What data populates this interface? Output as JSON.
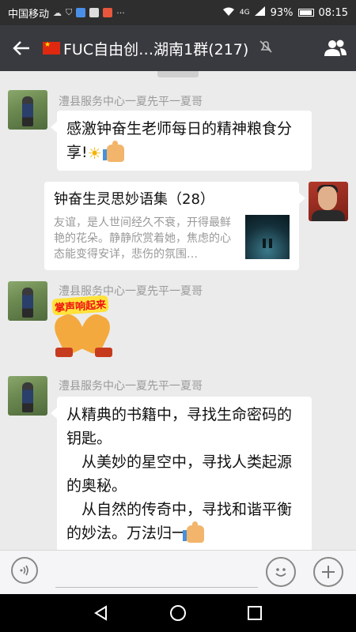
{
  "status": {
    "carrier": "中国移动",
    "network": "4G",
    "battery": "93%",
    "time": "08:15"
  },
  "header": {
    "back_icon": "arrow-left-icon",
    "title": "FUC自由创…湖南1群(217)",
    "mute_icon": "bell-muted-icon",
    "members_icon": "members-icon"
  },
  "messages": [
    {
      "type": "text",
      "sender": "澧县服务中心一夏先平一夏哥",
      "text": "感激钟奋生老师每日的精神粮食分享!",
      "emojis": [
        "sun",
        "thumbs-up"
      ]
    },
    {
      "type": "link",
      "self": true,
      "title": "钟奋生灵思妙语集（28）",
      "desc": "友谊，是人世间经久不衰，开得最鲜艳的花朵。静静欣赏着她，焦虑的心态能变得安详，悲伤的氛围…"
    },
    {
      "type": "sticker",
      "sender": "澧县服务中心一夏先平一夏哥",
      "label": "掌声响起来"
    },
    {
      "type": "text",
      "sender": "澧县服务中心一夏先平一夏哥",
      "lines": [
        "从精典的书籍中，寻找生命密码的",
        "钥匙。",
        "　从美妙的星空中，寻找人类起源",
        "的奥秘。",
        "　从自然的传奇中，寻找和谐平衡",
        "的妙法。万法归一"
      ],
      "emojis": [
        "thumbs-up"
      ]
    }
  ],
  "input": {
    "voice_icon": "voice-icon",
    "emoji_icon": "emoji-icon",
    "plus_icon": "plus-icon"
  },
  "nav": [
    "back-icon",
    "home-icon",
    "recent-apps-icon"
  ]
}
